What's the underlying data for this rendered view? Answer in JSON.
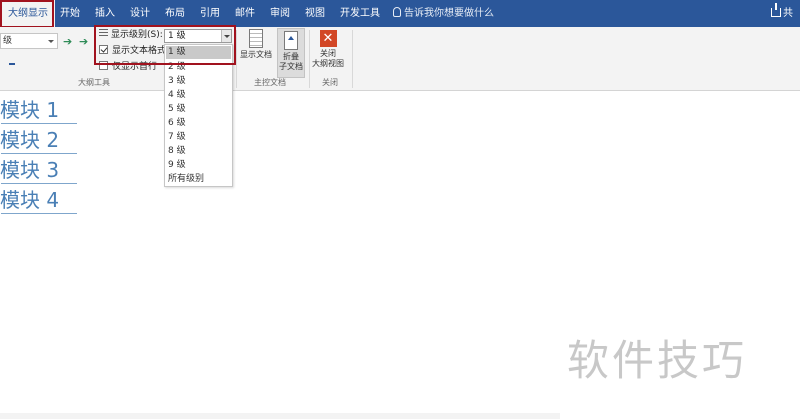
{
  "tabs": [
    {
      "label": "大纲显示",
      "active": true
    },
    {
      "label": "开始"
    },
    {
      "label": "插入"
    },
    {
      "label": "设计"
    },
    {
      "label": "布局"
    },
    {
      "label": "引用"
    },
    {
      "label": "邮件"
    },
    {
      "label": "审阅"
    },
    {
      "label": "视图"
    },
    {
      "label": "开发工具"
    }
  ],
  "tell_me": "告诉我你想要做什么",
  "share": "共",
  "ribbon": {
    "outline_level_value": "级",
    "show_level_label": "显示级别(S):",
    "show_level_value": "1 级",
    "show_text_format_label": "显示文本格式",
    "show_first_line_label": "仅显示首行",
    "outline_tools_label": "大纲工具",
    "show_document_label": "显示文档",
    "collapse_subdocs_line1": "折叠",
    "collapse_subdocs_line2": "子文档",
    "master_document_label": "主控文档",
    "close_outline_line1": "关闭",
    "close_outline_line2": "大纲视图",
    "close_group_label": "关闭"
  },
  "dropdown_items": [
    "1 级",
    "2 级",
    "3 级",
    "4 级",
    "5 级",
    "6 级",
    "7 级",
    "8 级",
    "9 级",
    "所有级别"
  ],
  "dropdown_selected": "1 级",
  "headings": [
    "模块 1",
    "模块 2",
    "模块 3",
    "模块 4"
  ],
  "watermark": "软件技巧",
  "colors": {
    "ribbon_blue": "#2b579a",
    "heading_blue": "#4a7fb5",
    "highlight_red": "#a1121e"
  }
}
